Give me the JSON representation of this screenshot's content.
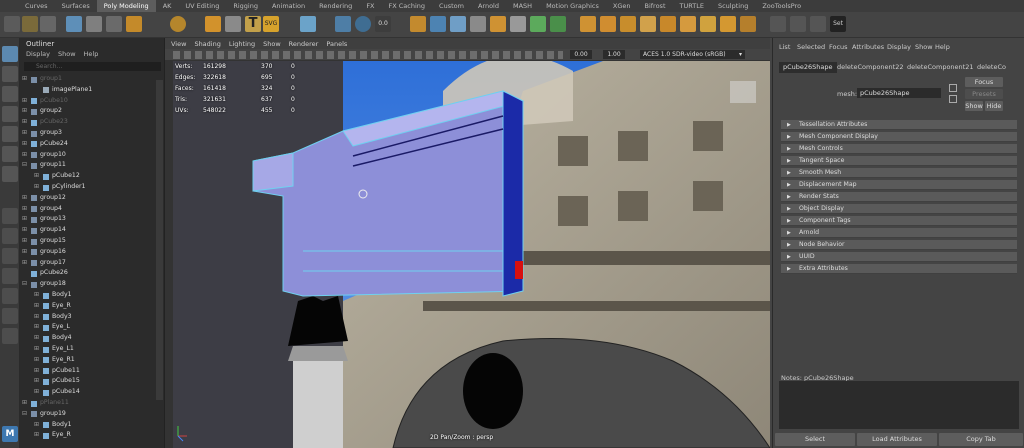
{
  "shelf": {
    "tabs": [
      "Curves",
      "Surfaces",
      "Poly Modeling",
      "AK",
      "UV Editing",
      "Rigging",
      "Animation",
      "Rendering",
      "FX",
      "FX Caching",
      "Custom",
      "Arnold",
      "MASH",
      "Motion Graphics",
      "XGen",
      "Bifrost",
      "TURTLE",
      "Sculpting",
      "ZooToolsPro"
    ],
    "active_tab": "Poly Modeling",
    "icon_text": {
      "zero": "0.0"
    }
  },
  "outliner": {
    "title": "Outliner",
    "menu": [
      "Display",
      "Show",
      "Help"
    ],
    "search_placeholder": "Search...",
    "items": [
      {
        "label": "group1",
        "indent": 1,
        "type": "group",
        "exp": "⊞",
        "dim": true
      },
      {
        "label": "imagePlane1",
        "indent": 2,
        "type": "plane",
        "exp": ""
      },
      {
        "label": "pCube10",
        "indent": 1,
        "type": "mesh",
        "exp": "⊞",
        "dim": true
      },
      {
        "label": "group2",
        "indent": 1,
        "type": "group",
        "exp": "⊞"
      },
      {
        "label": "pCube23",
        "indent": 1,
        "type": "mesh",
        "exp": "⊞",
        "dim": true
      },
      {
        "label": "group3",
        "indent": 1,
        "type": "group",
        "exp": "⊞"
      },
      {
        "label": "pCube24",
        "indent": 1,
        "type": "mesh",
        "exp": "⊞"
      },
      {
        "label": "group10",
        "indent": 1,
        "type": "group",
        "exp": "⊞"
      },
      {
        "label": "group11",
        "indent": 1,
        "type": "group",
        "exp": "⊟"
      },
      {
        "label": "pCube12",
        "indent": 2,
        "type": "mesh",
        "exp": "⊞"
      },
      {
        "label": "pCylinder1",
        "indent": 2,
        "type": "mesh",
        "exp": "⊞"
      },
      {
        "label": "group12",
        "indent": 1,
        "type": "group",
        "exp": "⊞"
      },
      {
        "label": "group4",
        "indent": 1,
        "type": "group",
        "exp": "⊞"
      },
      {
        "label": "group13",
        "indent": 1,
        "type": "group",
        "exp": "⊞"
      },
      {
        "label": "group14",
        "indent": 1,
        "type": "group",
        "exp": "⊞"
      },
      {
        "label": "group15",
        "indent": 1,
        "type": "group",
        "exp": "⊞"
      },
      {
        "label": "group16",
        "indent": 1,
        "type": "group",
        "exp": "⊞"
      },
      {
        "label": "group17",
        "indent": 1,
        "type": "group",
        "exp": "⊞"
      },
      {
        "label": "pCube26",
        "indent": 1,
        "type": "mesh",
        "exp": ""
      },
      {
        "label": "group18",
        "indent": 1,
        "type": "group",
        "exp": "⊟"
      },
      {
        "label": "Body1",
        "indent": 2,
        "type": "mesh",
        "exp": "⊞"
      },
      {
        "label": "Eye_R",
        "indent": 2,
        "type": "mesh",
        "exp": "⊞"
      },
      {
        "label": "Body3",
        "indent": 2,
        "type": "mesh",
        "exp": "⊞"
      },
      {
        "label": "Eye_L",
        "indent": 2,
        "type": "mesh",
        "exp": "⊞"
      },
      {
        "label": "Body4",
        "indent": 2,
        "type": "mesh",
        "exp": "⊞"
      },
      {
        "label": "Eye_L1",
        "indent": 2,
        "type": "mesh",
        "exp": "⊞"
      },
      {
        "label": "Eye_R1",
        "indent": 2,
        "type": "mesh",
        "exp": "⊞"
      },
      {
        "label": "pCube11",
        "indent": 2,
        "type": "mesh",
        "exp": "⊞"
      },
      {
        "label": "pCube15",
        "indent": 2,
        "type": "mesh",
        "exp": "⊞"
      },
      {
        "label": "pCube14",
        "indent": 2,
        "type": "mesh",
        "exp": "⊞"
      },
      {
        "label": "pPlane11",
        "indent": 1,
        "type": "mesh",
        "exp": "⊞",
        "dim": true
      },
      {
        "label": "group19",
        "indent": 1,
        "type": "group",
        "exp": "⊟"
      },
      {
        "label": "Body1",
        "indent": 2,
        "type": "mesh",
        "exp": "⊞"
      },
      {
        "label": "Eye_R",
        "indent": 2,
        "type": "mesh",
        "exp": "⊞"
      }
    ]
  },
  "panel": {
    "menu": [
      "View",
      "Shading",
      "Lighting",
      "Show",
      "Renderer",
      "Panels"
    ],
    "field1": "0.00",
    "field2": "1.00",
    "colorspace": "ACES 1.0 SDR-video (sRGB)"
  },
  "hud": {
    "rows": [
      {
        "label": "Verts:",
        "a": "161298",
        "b": "370",
        "c": "0"
      },
      {
        "label": "Edges:",
        "a": "322618",
        "b": "695",
        "c": "0"
      },
      {
        "label": "Faces:",
        "a": "161418",
        "b": "324",
        "c": "0"
      },
      {
        "label": "Tris:",
        "a": "321631",
        "b": "637",
        "c": "0"
      },
      {
        "label": "UVs:",
        "a": "548022",
        "b": "455",
        "c": "0"
      }
    ],
    "camera": "2D Pan/Zoom : persp"
  },
  "attr": {
    "menu": [
      "List",
      "Selected",
      "Focus",
      "Attributes",
      "Display",
      "Show",
      "Help"
    ],
    "tabs": [
      "pCube26Shape",
      "deleteComponent22",
      "deleteComponent21",
      "deleteCo"
    ],
    "mesh_label": "mesh:",
    "mesh_value": "pCube26Shape",
    "focus": "Focus",
    "presets": "Presets",
    "show": "Show",
    "hide": "Hide",
    "sections": [
      "Tessellation Attributes",
      "Mesh Component Display",
      "Mesh Controls",
      "Tangent Space",
      "Smooth Mesh",
      "Displacement Map",
      "Render Stats",
      "Object Display",
      "Component Tags",
      "Arnold",
      "Node Behavior",
      "UUID",
      "Extra Attributes"
    ],
    "notes_label": "Notes:  pCube26Shape",
    "bottom": [
      "Select",
      "Load Attributes",
      "Copy Tab"
    ]
  },
  "colors": {
    "ui_dark": "#444444",
    "accent": "#5285a6",
    "mesh": "#8d8fd8",
    "wire": "#6fd0f0"
  }
}
